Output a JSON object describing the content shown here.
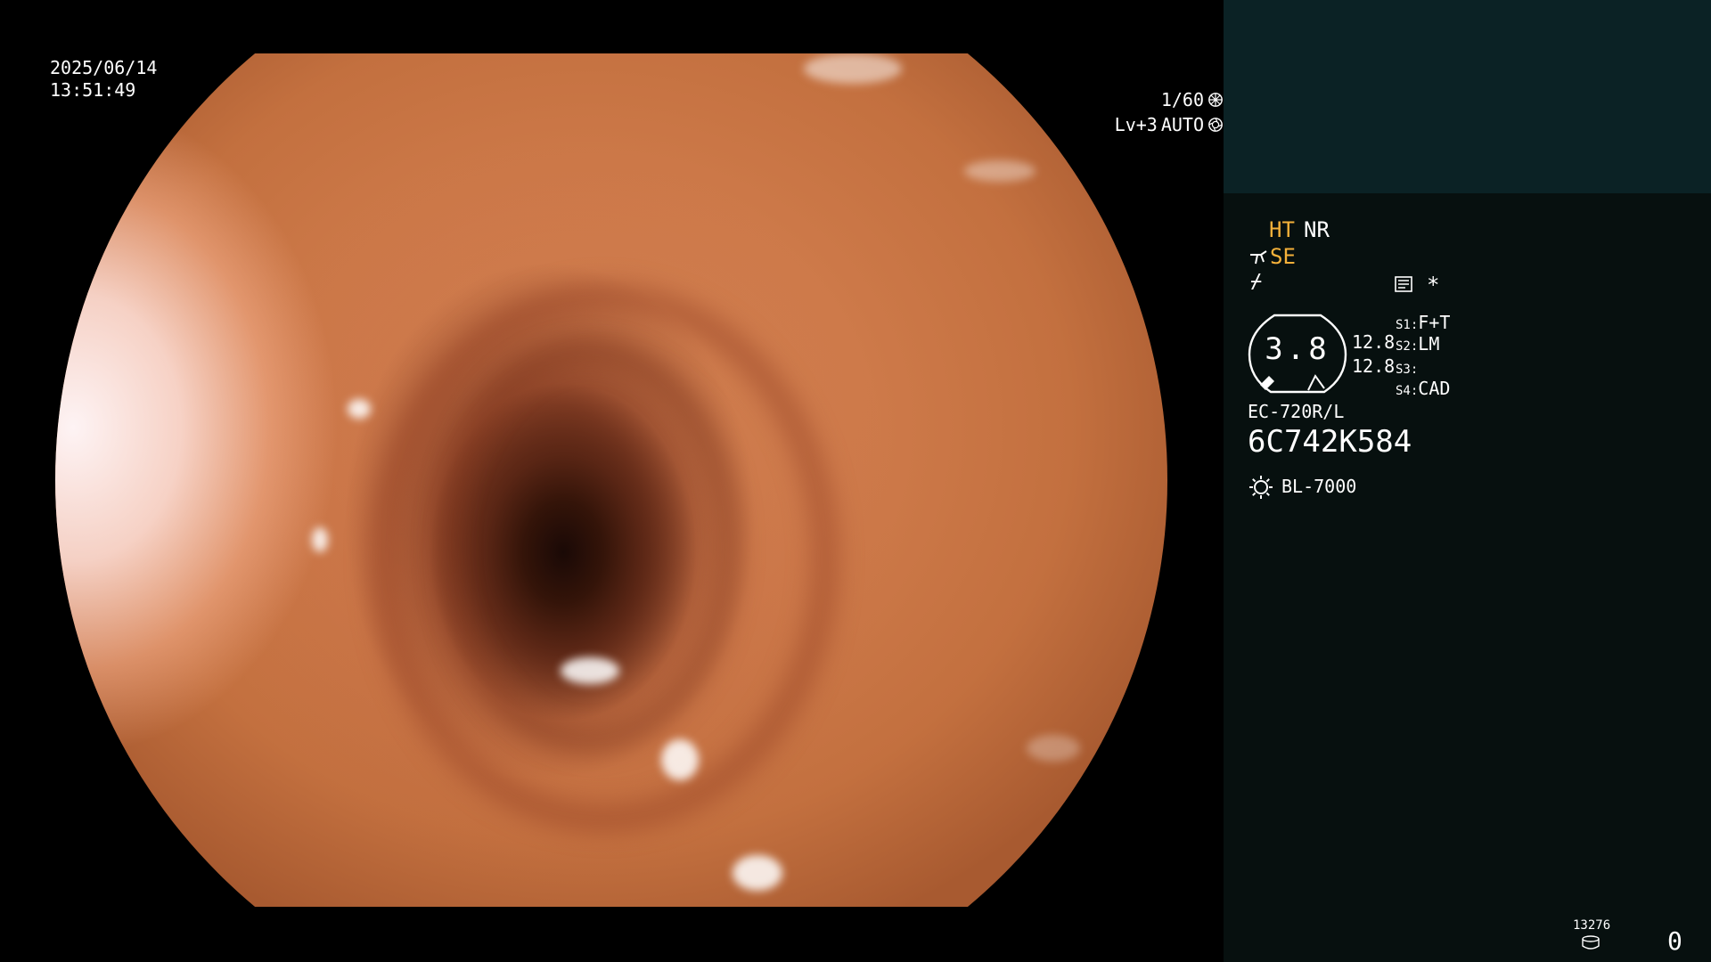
{
  "overlay": {
    "date": "2025/06/14",
    "time": "13:51:49",
    "shutter": "1/60",
    "shutter_icon": "aperture-icon",
    "light_level": "Lv+3",
    "exposure_mode": "AUTO",
    "exposure_icon": "iris-icon"
  },
  "panel": {
    "modes": {
      "ht": "HT",
      "nr": "NR",
      "se": "SE"
    },
    "icons": {
      "se": "scope-tip-icon",
      "slash": "freeze-icon",
      "memo": "memo-icon",
      "star": "*"
    },
    "slash_glyph": "⌿",
    "gauge": {
      "value": "3.8",
      "value_top": "12.8",
      "value_bottom": "12.8"
    },
    "switches": [
      {
        "key": "S1:",
        "value": "F+T"
      },
      {
        "key": "S2:",
        "value": "LM"
      },
      {
        "key": "S3:",
        "value": ""
      },
      {
        "key": "S4:",
        "value": "CAD"
      }
    ],
    "scope_model": "EC-720R/L",
    "scope_serial": "6C742K584",
    "light_source": "BL-7000",
    "storage_count": "13276",
    "record_count": "0"
  },
  "colors": {
    "accent_yellow": "#f4b13a",
    "panel_bg": "#07100f",
    "panel_header_bg": "#0b2225",
    "text": "#ffffff"
  }
}
